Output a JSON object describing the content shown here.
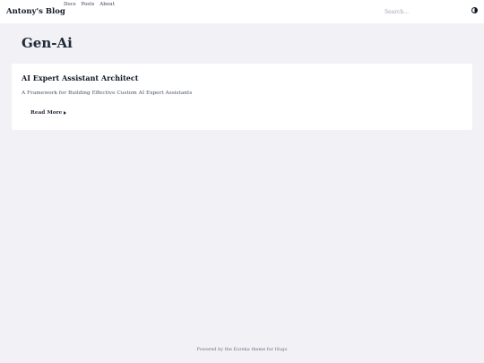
{
  "header": {
    "brand": "Antony's Blog",
    "nav": [
      {
        "label": "Docs"
      },
      {
        "label": "Posts"
      },
      {
        "label": "About"
      }
    ],
    "search": {
      "placeholder": "Search...",
      "value": ""
    },
    "theme_toggle_icon": "half-circle-contrast-icon"
  },
  "main": {
    "title": "Gen-Ai",
    "posts": [
      {
        "title": "AI Expert Assistant Architect",
        "summary": "A Framework for Building Effective Custom AI Expert Assistants",
        "read_more": "Read More",
        "read_more_icon": "caret-right-icon"
      }
    ]
  },
  "footer": {
    "prefix": "Powered by the",
    "theme": "Eureka",
    "middle": "theme for",
    "engine": "Hugo"
  },
  "colors": {
    "background": "#f2f1f6",
    "surface": "#ffffff",
    "text": "#1f2937",
    "muted": "#6b7280"
  }
}
